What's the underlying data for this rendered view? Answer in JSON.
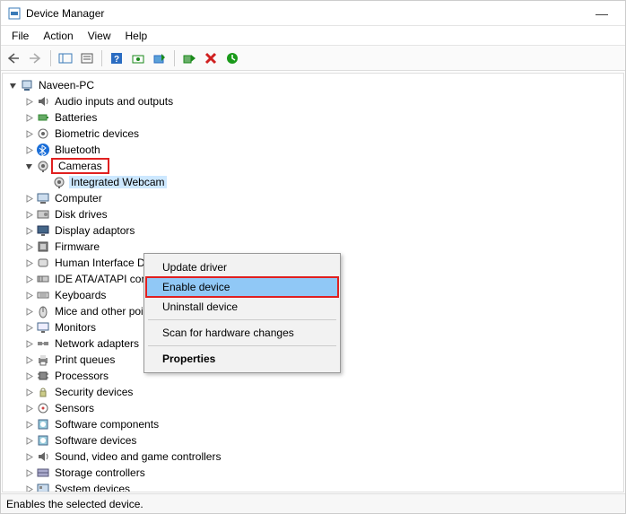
{
  "window": {
    "title": "Device Manager"
  },
  "menu": {
    "file": "File",
    "action": "Action",
    "view": "View",
    "help": "Help"
  },
  "root": {
    "label": "Naveen-PC"
  },
  "categories": [
    {
      "label": "Audio inputs and outputs",
      "icon": "audio"
    },
    {
      "label": "Batteries",
      "icon": "battery"
    },
    {
      "label": "Biometric devices",
      "icon": "biometric"
    },
    {
      "label": "Bluetooth",
      "icon": "bluetooth"
    },
    {
      "label": "Cameras",
      "icon": "camera",
      "expanded": true,
      "highlight": true,
      "children": [
        {
          "label": "Integrated Webcam",
          "icon": "camera",
          "selected": true
        }
      ]
    },
    {
      "label": "Computer",
      "icon": "computer"
    },
    {
      "label": "Disk drives",
      "icon": "disk"
    },
    {
      "label": "Display adaptors",
      "icon": "display"
    },
    {
      "label": "Firmware",
      "icon": "firmware"
    },
    {
      "label": "Human Interface Devices",
      "icon": "hid"
    },
    {
      "label": "IDE ATA/ATAPI controllers",
      "icon": "ide"
    },
    {
      "label": "Keyboards",
      "icon": "keyboard"
    },
    {
      "label": "Mice and other pointing devices",
      "icon": "mouse"
    },
    {
      "label": "Monitors",
      "icon": "monitor"
    },
    {
      "label": "Network adapters",
      "icon": "network"
    },
    {
      "label": "Print queues",
      "icon": "printer"
    },
    {
      "label": "Processors",
      "icon": "cpu"
    },
    {
      "label": "Security devices",
      "icon": "security"
    },
    {
      "label": "Sensors",
      "icon": "sensor"
    },
    {
      "label": "Software components",
      "icon": "software"
    },
    {
      "label": "Software devices",
      "icon": "software"
    },
    {
      "label": "Sound, video and game controllers",
      "icon": "audio"
    },
    {
      "label": "Storage controllers",
      "icon": "storage"
    },
    {
      "label": "System devices",
      "icon": "system"
    }
  ],
  "context_menu": {
    "update": "Update driver",
    "enable": "Enable device",
    "uninstall": "Uninstall device",
    "scan": "Scan for hardware changes",
    "properties": "Properties"
  },
  "status": "Enables the selected device."
}
